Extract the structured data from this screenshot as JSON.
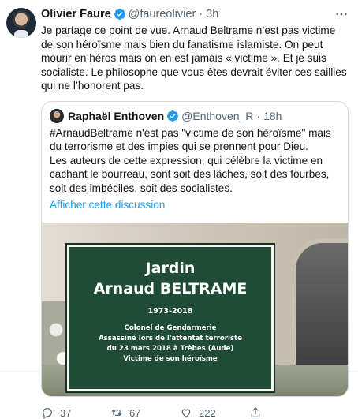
{
  "tweet": {
    "author_name": "Olivier Faure",
    "handle": "@faureolivier",
    "separator": "·",
    "time": "3h",
    "text": "Je partage ce point de vue. Arnaud Beltrame n’est pas victime de son héroïsme mais bien du fanatisme islamiste. On peut mourir en héros mais on en est jamais « victime ». Et je suis socialiste. Le philosophe que vous êtes devrait éviter ces saillies qui ne l’honorent pas.",
    "more_icon": "more-horizontal-icon"
  },
  "quoted": {
    "author_name": "Raphaël Enthoven",
    "handle": "@Enthoven_R",
    "separator": "·",
    "time": "18h",
    "text": "#ArnaudBeltrame n'est pas \"victime de son héroïsme\" mais du terrorisme et des impies qui se prennent pour Dieu.\nLes auteurs de cette expression, qui célèbre la victime en cachant le bourreau, sont soit des lâches, soit des fourbes, soit des imbéciles, soit des socialistes.",
    "link": "Afficher cette discussion",
    "image": {
      "plaque_line1": "Jardin",
      "plaque_line2": "Arnaud BELTRAME",
      "plaque_line3": "1973-2018",
      "plaque_line4": "Colonel de Gendarmerie",
      "plaque_line5": "Assassiné lors de l'attentat terroriste",
      "plaque_line6": "du 23 mars 2018 à Trèbes (Aude)",
      "plaque_line7": "Victime de son héroïsme"
    }
  },
  "actions": {
    "reply_count": "37",
    "retweet_count": "67",
    "like_count": "222"
  },
  "colors": {
    "accent": "#1d9bf0",
    "secondary_text": "#536471"
  }
}
